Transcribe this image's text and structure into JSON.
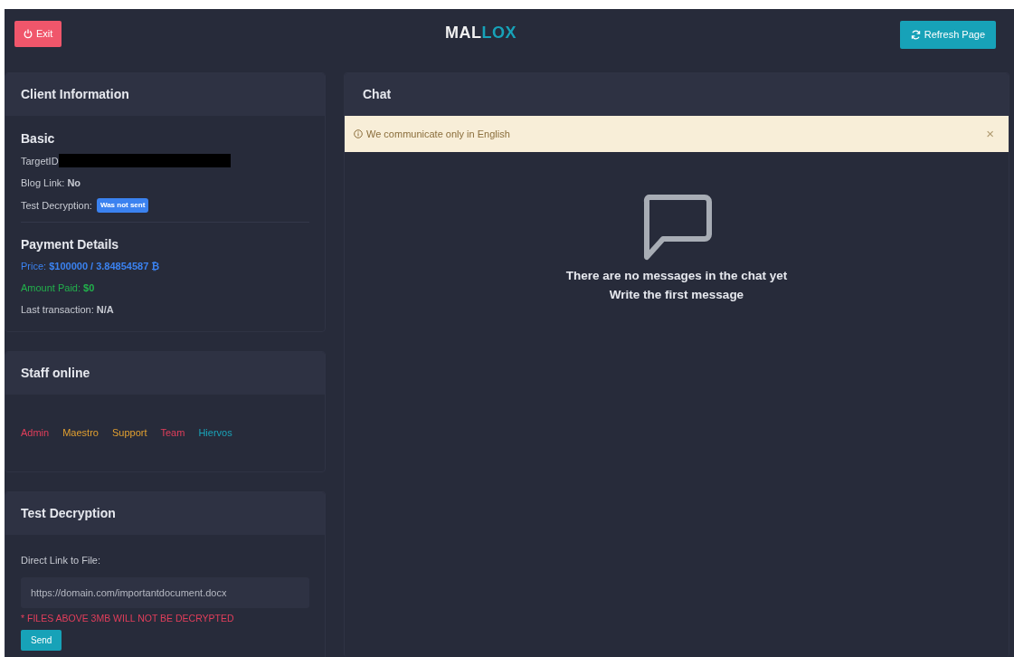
{
  "header": {
    "exit_button": "Exit",
    "logo": [
      {
        "text": "MAL",
        "accent": false
      },
      {
        "text": "LOX",
        "accent": true
      }
    ],
    "refresh_button": "Refresh Page"
  },
  "client_information": {
    "title": "Client Information",
    "basic": {
      "title": "Basic",
      "target_id_label": "TargetID",
      "target_id_redacted": true,
      "blog_link_label": "Blog Link:",
      "blog_link_value": "No",
      "test_decryption_label": "Test Decryption:",
      "test_decryption_badge": "Was not sent"
    },
    "payment": {
      "title": "Payment Details",
      "price_label": "Price:",
      "price_value": "$100000 / 3.84854587 ₿",
      "paid_label": "Amount Paid:",
      "paid_value": "$0",
      "last_label": "Last transaction:",
      "last_value": "N/A"
    }
  },
  "staff_online": {
    "title": "Staff online",
    "staff": [
      {
        "name": "Admin",
        "color": "#e23e5b"
      },
      {
        "name": "Maestro",
        "color": "#e2a030"
      },
      {
        "name": "Support",
        "color": "#e2a030"
      },
      {
        "name": "Team",
        "color": "#e23e5b"
      },
      {
        "name": "Hiervos",
        "color": "#1aa3b8"
      }
    ]
  },
  "test_decryption": {
    "title": "Test Decryption",
    "field_label": "Direct Link to File:",
    "placeholder": "https://domain.com/importantdocument.docx",
    "warning": "* FILES ABOVE 3MB WILL NOT BE DECRYPTED",
    "send_button": "Send"
  },
  "chat": {
    "title": "Chat",
    "alert": "We communicate only in English",
    "alert_close": "×",
    "empty_lines": [
      "There are no messages in the chat yet",
      "Write the first message"
    ]
  }
}
